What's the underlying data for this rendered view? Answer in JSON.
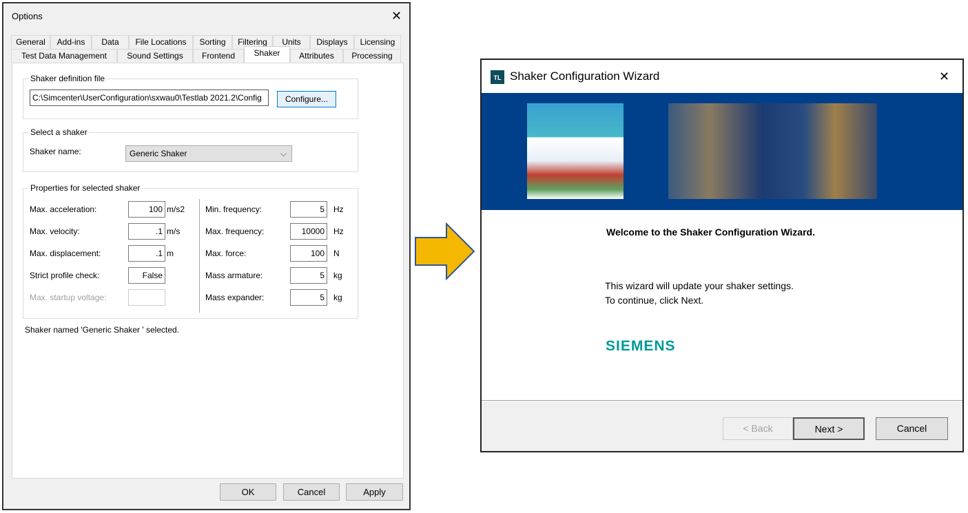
{
  "options": {
    "title": "Options",
    "tabs_row1": [
      "General",
      "Add-ins",
      "Data",
      "File Locations",
      "Sorting",
      "Filtering",
      "Units",
      "Displays",
      "Licensing"
    ],
    "tabs_row2": [
      "Test Data Management",
      "Sound Settings",
      "Frontend",
      "Shaker",
      "Attributes",
      "Processing"
    ],
    "active_tab": "Shaker",
    "def_group": "Shaker definition file",
    "def_path": "C:\\Simcenter\\UserConfiguration\\sxwau0\\Testlab 2021.2\\Config",
    "configure": "Configure...",
    "select_group": "Select a shaker",
    "shaker_name_label": "Shaker name:",
    "shaker_name": "Generic Shaker",
    "props_group": "Properties for selected shaker",
    "left_props": [
      {
        "label": "Max. acceleration:",
        "value": "100",
        "unit": "m/s2"
      },
      {
        "label": "Max. velocity:",
        "value": ".1",
        "unit": "m/s"
      },
      {
        "label": "Max. displacement:",
        "value": ".1",
        "unit": "m"
      },
      {
        "label": "Strict profile check:",
        "value": "False",
        "unit": ""
      },
      {
        "label": "Max. startup voltage:",
        "value": "",
        "unit": ""
      }
    ],
    "right_props": [
      {
        "label": "Min. frequency:",
        "value": "5",
        "unit": "Hz"
      },
      {
        "label": "Max. frequency:",
        "value": "10000",
        "unit": "Hz"
      },
      {
        "label": "Max. force:",
        "value": "100",
        "unit": "N"
      },
      {
        "label": "Mass armature:",
        "value": "5",
        "unit": "kg"
      },
      {
        "label": "Mass expander:",
        "value": "5",
        "unit": "kg"
      }
    ],
    "status": "Shaker named 'Generic Shaker ' selected.",
    "ok": "OK",
    "cancel": "Cancel",
    "apply": "Apply"
  },
  "wizard": {
    "icon_text": "TL",
    "title": "Shaker Configuration Wizard",
    "welcome": "Welcome to the Shaker Configuration Wizard.",
    "line1": "This wizard will update your shaker settings.",
    "line2": "To continue, click Next.",
    "logo": "SIEMENS",
    "back": "< Back",
    "next": "Next >",
    "cancel": "Cancel",
    "banner_color": "#003f8a",
    "logo_color": "#009999"
  },
  "arrow_color": "#f5b800"
}
